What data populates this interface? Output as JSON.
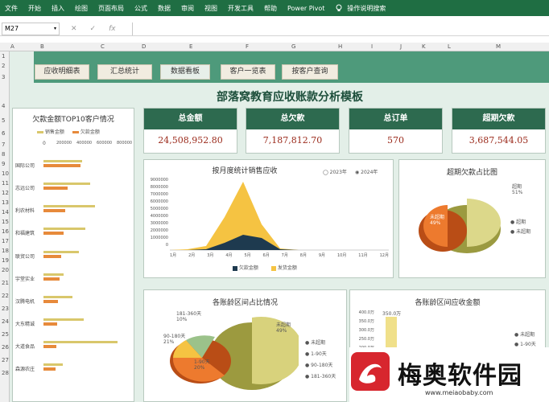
{
  "ribbon": {
    "menus": [
      "文件",
      "开始",
      "插入",
      "绘图",
      "页面布局",
      "公式",
      "数据",
      "审阅",
      "视图",
      "开发工具",
      "帮助",
      "Power Pivot"
    ],
    "help_text": "操作说明搜索"
  },
  "formula_bar": {
    "cell_ref": "M27",
    "cancel": "✕",
    "confirm": "✓",
    "fx": "fx",
    "value": ""
  },
  "columns": [
    "A",
    "B",
    "C",
    "D",
    "E",
    "F",
    "G",
    "H",
    "I",
    "J",
    "K",
    "L",
    "M"
  ],
  "rows": [
    "1",
    "2",
    "3",
    "4",
    "5",
    "6",
    "7",
    "8",
    "9",
    "10",
    "11",
    "12",
    "13",
    "14",
    "15",
    "16",
    "17",
    "18",
    "19",
    "20",
    "21",
    "22",
    "23",
    "24",
    "25",
    "26",
    "27",
    "28"
  ],
  "tabs": [
    "应收明细表",
    "汇总统计",
    "数据看板",
    "客户一览表",
    "按客户查询"
  ],
  "title": "部落窝教育应收账款分析模板",
  "kpis": [
    {
      "label": "总金额",
      "value": "24,508,952.80"
    },
    {
      "label": "总欠款",
      "value": "7,187,812.70"
    },
    {
      "label": "总订单",
      "value": "570"
    },
    {
      "label": "超期欠款",
      "value": "3,687,544.05"
    }
  ],
  "top10": {
    "title": "欠款金额TOP10客户情况",
    "legend": [
      "销售金额",
      "欠款金额"
    ],
    "axis": [
      "0",
      "200000",
      "400000",
      "600000",
      "800000"
    ],
    "customers": [
      "国际公司",
      "志远公司",
      "利农材料",
      "和福建筑",
      "联贸公司",
      "宇堂实业",
      "汉腾电机",
      "大东精诚",
      "大道食品",
      "森源农庄"
    ]
  },
  "monthly": {
    "title": "按月度统计销售应收",
    "years": [
      "2023年",
      "2024年"
    ],
    "yticks": [
      "9000000",
      "8000000",
      "7000000",
      "6000000",
      "5000000",
      "4000000",
      "3000000",
      "2000000",
      "1000000",
      "0"
    ],
    "months": [
      "1月",
      "2月",
      "3月",
      "4月",
      "5月",
      "6月",
      "7月",
      "8月",
      "9月",
      "10月",
      "11月",
      "12月"
    ],
    "legend": [
      "欠款金额",
      "发货金额"
    ]
  },
  "overdue": {
    "title": "超期欠款占比图",
    "labels": [
      "超期\n51%",
      "未超期\n49%"
    ],
    "legend": [
      "超期",
      "未超期"
    ]
  },
  "aging": {
    "title": "各账龄区间占比情况",
    "labels": [
      "181-360天\n10%",
      "90-180天\n21%",
      "1-90天\n20%",
      "未超期\n49%"
    ],
    "legend": [
      "未超期",
      "1-90天",
      "90-180天",
      "181-360天"
    ]
  },
  "aging_amount": {
    "title": "各账龄区间应收金额",
    "yticks": [
      "400.0万",
      "350.0万",
      "300.0万",
      "250.0万",
      "200.0万"
    ],
    "bar_label": "350.0万",
    "legend": [
      "未超期",
      "1-90天"
    ]
  },
  "watermark": {
    "name": "梅奥软件园",
    "url": "www.meiaobaby.com"
  },
  "colors": {
    "ribbon": "#1f6e43",
    "band": "#4e9a7b",
    "kpi_head": "#2d6a4f",
    "sales": "#d9c76b",
    "debt": "#e78a3b",
    "area_dark": "#1e3a4f",
    "area_light": "#f5c342"
  }
}
